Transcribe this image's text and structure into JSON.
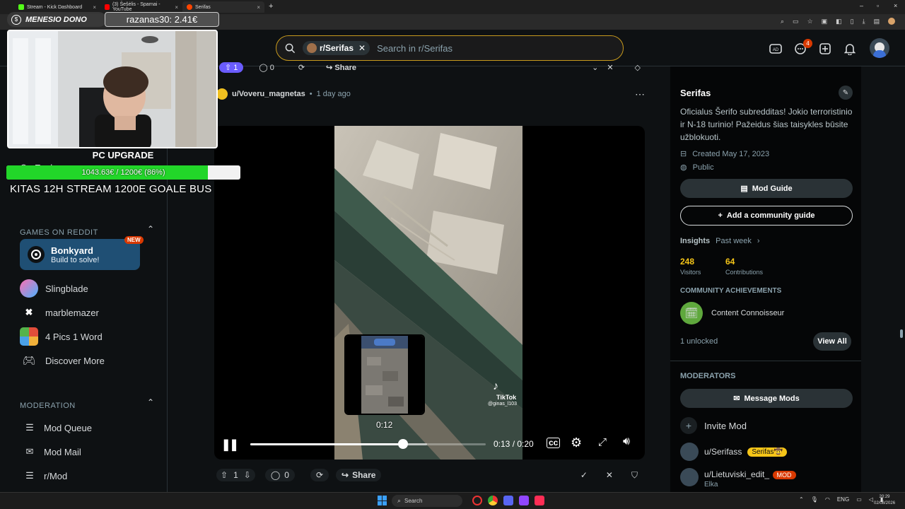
{
  "browser": {
    "tabs": [
      {
        "title": "Stream - Kick Dashboard",
        "color": "#53fc18"
      },
      {
        "title": "(3) Šešėlis - Sparnai - YouTube",
        "color": "#ff0000"
      },
      {
        "title": "Serifas",
        "color": "#ff4500"
      }
    ]
  },
  "stream_overlay": {
    "donate_label": "MENESIO DONO",
    "donate_value": "razanas30: 2.41€",
    "pc_upgrade_title": "PC UPGRADE",
    "progress_label": "1043.63€ / 1200€ (86%)",
    "progress_fraction": 0.86,
    "goal_text": "KITAS 12H STREAM 1200E GOALE BUS"
  },
  "header": {
    "community_chip": "r/Serifas",
    "search_placeholder": "Search in r/Serifas",
    "notification_count": "4"
  },
  "sidebar": {
    "explore_label": "Explore",
    "games_heading": "GAMES ON REDDIT",
    "featured_game": {
      "name": "Bonkyard",
      "subtitle": "Build to solve!",
      "badge": "NEW"
    },
    "games": [
      {
        "name": "Slingblade",
        "icon": "slingblade-icon"
      },
      {
        "name": "marblemazer",
        "icon": "marblemazer-icon"
      },
      {
        "name": "4 Pics 1 Word",
        "icon": "4pics-icon"
      },
      {
        "name": "Discover More",
        "icon": "gamepad-icon"
      }
    ],
    "moderation_heading": "MODERATION",
    "moderation_items": [
      {
        "name": "Mod Queue",
        "icon": "queue-icon"
      },
      {
        "name": "Mod Mail",
        "icon": "mail-icon"
      },
      {
        "name": "r/Mod",
        "icon": "list-icon"
      }
    ]
  },
  "post_prev": {
    "votes": "1",
    "comments": "0",
    "share": "Share"
  },
  "post": {
    "author": "u/Voveru_magnetas",
    "time": "1 day ago",
    "video": {
      "hover_time": "0:12",
      "time_display": "0:13 / 0:20",
      "progress_fraction": 0.65,
      "buffer_fraction": 0.75,
      "tiktok_label": "TikTok",
      "tiktok_user": "@ginas_l103"
    },
    "votes": "1",
    "comments": "0",
    "share": "Share"
  },
  "community": {
    "name": "Serifas",
    "description": "Oficialus Šerifo subredditas! Jokio terroristinio ir N-18 turinio! Pažeidus šias taisykles būsite užblokuoti.",
    "created": "Created May 17, 2023",
    "visibility": "Public",
    "mod_guide": "Mod Guide",
    "add_guide": "Add a community guide",
    "insights_label": "Insights",
    "insights_period": "Past week",
    "visitors_value": "248",
    "visitors_label": "Visitors",
    "contrib_value": "64",
    "contrib_label": "Contributions",
    "achievements_heading": "COMMUNITY ACHIEVEMENTS",
    "achievement": "Content Connoisseur",
    "unlocked": "1 unlocked",
    "view_all": "View All",
    "moderators_heading": "MODERATORS",
    "message_mods": "Message Mods",
    "invite_mod": "Invite Mod",
    "mods": [
      {
        "name": "u/Serifass",
        "flair": "Serifas🤠",
        "flair_color": "#f5c518"
      },
      {
        "name": "u/Lietuviski_edit_",
        "flair": "MOD",
        "flair_color": "#d93900",
        "sub": "Elka"
      }
    ]
  },
  "taskbar": {
    "search_placeholder": "Search",
    "lang": "ENG",
    "time": "20:29",
    "date": "02/08/2026"
  },
  "colors": {
    "accent_orange": "#ff4500",
    "search_border": "#c79a1d",
    "progress_green": "#22d629",
    "bonkyard_bg": "#1f4f74"
  }
}
